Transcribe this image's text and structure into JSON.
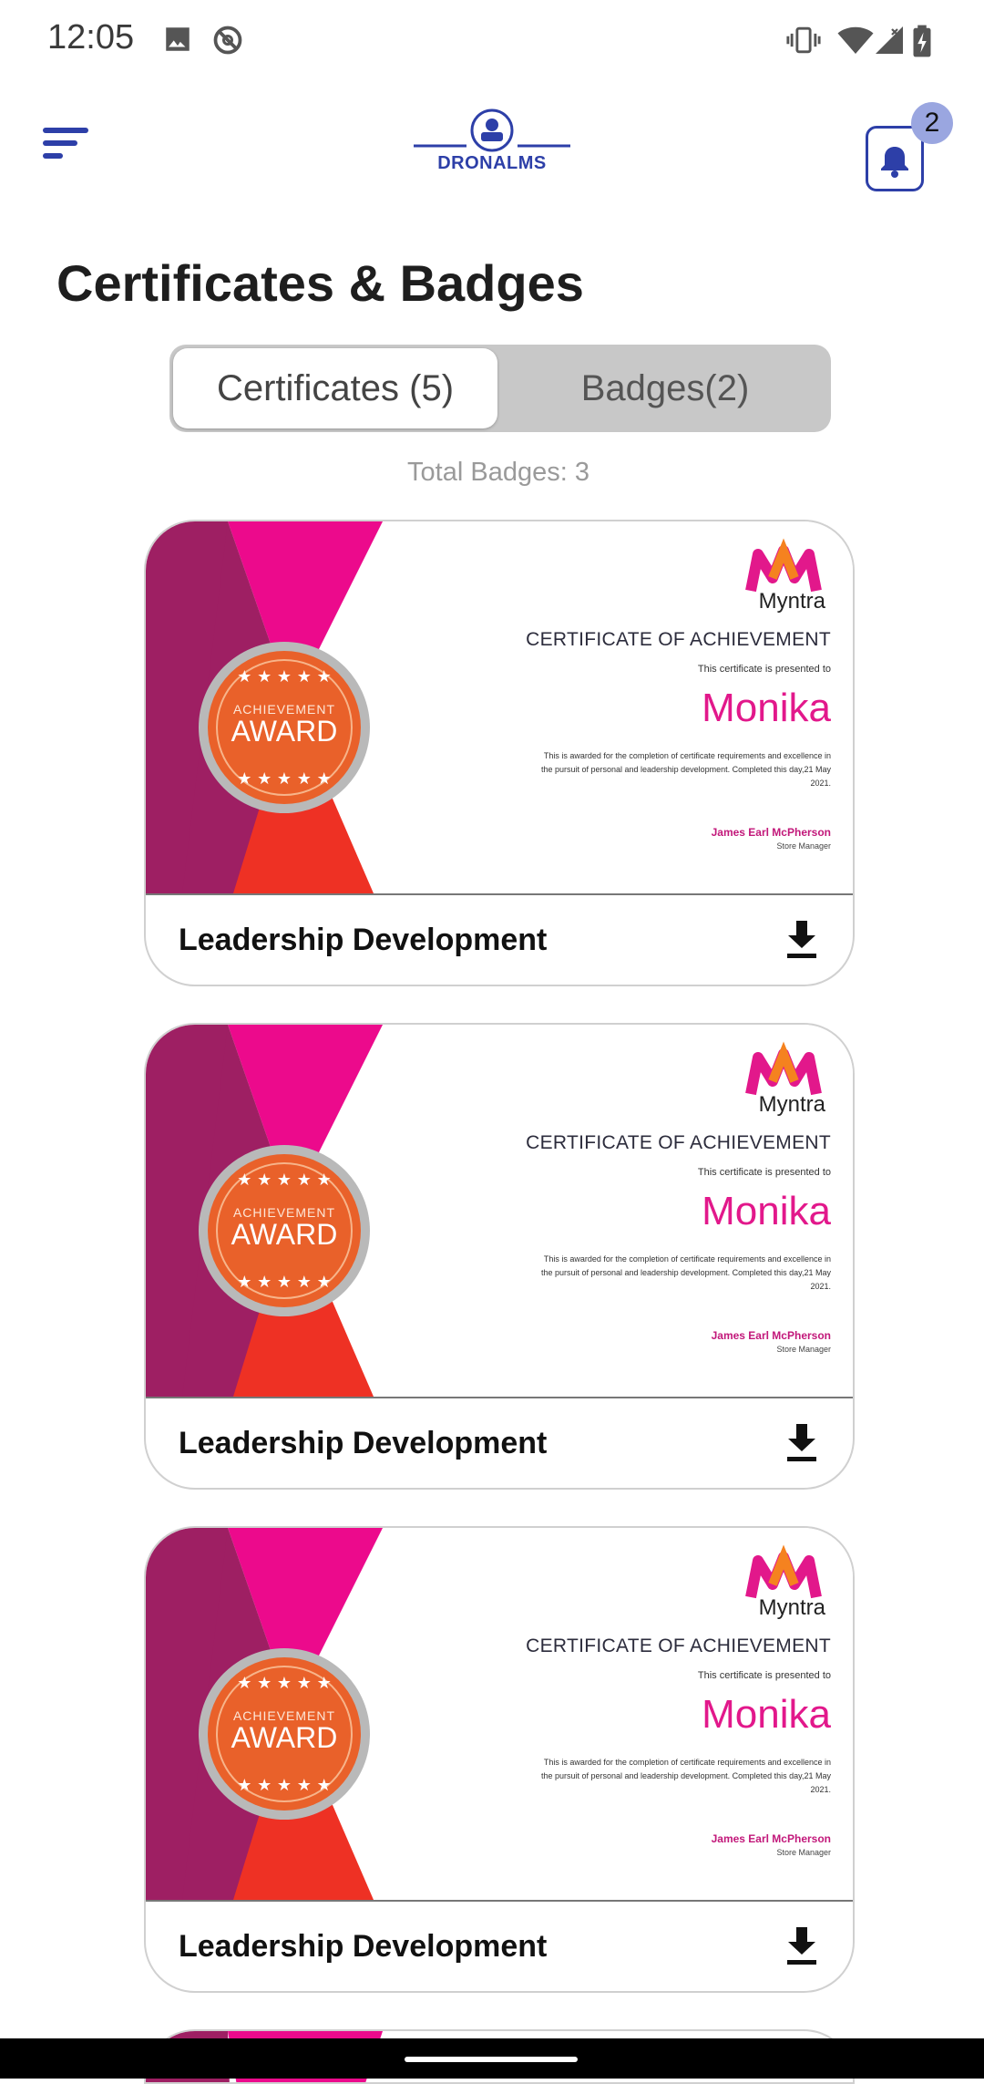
{
  "status_bar": {
    "time": "12:05"
  },
  "header": {
    "logo_text": "DRONALMS",
    "notification_count": "2"
  },
  "page": {
    "title": "Certificates & Badges",
    "tabs": [
      {
        "label": "Certificates (5)",
        "active": true
      },
      {
        "label": "Badges(2)",
        "active": false
      }
    ],
    "total_badges": "Total Badges: 3"
  },
  "certificates": [
    {
      "brand": "Myntra",
      "heading": "CERTIFICATE OF ACHIEVEMENT",
      "presented": "This certificate is presented to",
      "name": "Monika",
      "description": "This is awarded for the completion of certificate requirements and excellence in the pursuit of personal and leadership development. Completed this day,21 May 2021.",
      "signer": "James Earl McPherson",
      "signer_role": "Store Manager",
      "seal_top": "ACHIEVEMENT",
      "seal_main": "AWARD",
      "title": "Leadership Development"
    },
    {
      "brand": "Myntra",
      "heading": "CERTIFICATE OF ACHIEVEMENT",
      "presented": "This certificate is presented to",
      "name": "Monika",
      "description": "This is awarded for the completion of certificate requirements and excellence in the pursuit of personal and leadership development. Completed this day,21 May 2021.",
      "signer": "James Earl McPherson",
      "signer_role": "Store Manager",
      "seal_top": "ACHIEVEMENT",
      "seal_main": "AWARD",
      "title": "Leadership Development"
    },
    {
      "brand": "Myntra",
      "heading": "CERTIFICATE OF ACHIEVEMENT",
      "presented": "This certificate is presented to",
      "name": "Monika",
      "description": "This is awarded for the completion of certificate requirements and excellence in the pursuit of personal and leadership development. Completed this day,21 May 2021.",
      "signer": "James Earl McPherson",
      "signer_role": "Store Manager",
      "seal_top": "ACHIEVEMENT",
      "seal_main": "AWARD",
      "title": "Leadership Development"
    }
  ],
  "colors": {
    "accent": "#2d3fa8",
    "badge": "#9aa6e0",
    "magenta": "#e2188b"
  },
  "icons": [
    "image-icon",
    "sync-disabled-icon",
    "vibrate-icon",
    "wifi-icon",
    "signal-icon",
    "battery-charging-icon",
    "menu-icon",
    "bell-icon",
    "download-icon"
  ]
}
